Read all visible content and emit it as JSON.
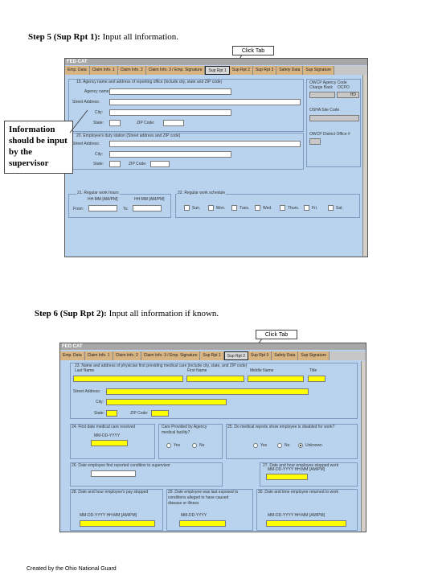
{
  "step5": {
    "title_bold": "Step 5 (Sup Rpt 1):",
    "title_rest": " Input all information.",
    "click_tab": "Click Tab",
    "callout": [
      "Information",
      "should be input",
      "by the",
      "supervisor"
    ],
    "app_logo": "FED CAT",
    "tabs": [
      "Emp. Data",
      "Claim Info. 1",
      "Claim Info. 2",
      "Claim Info. 3 / Emp. Signature",
      "Sup Rpt 1",
      "Sup Rpt 2",
      "Sup Rpt 3",
      "Safety Data",
      "Sup Signature"
    ],
    "active_tab": 4,
    "sec19": {
      "title": "19. Agency name and address of reporting office (include city, state and ZIP code)",
      "agency_name": "Agency name:",
      "street": "Street Address:",
      "city": "City:",
      "state": "State:",
      "zip": "ZIP Code:"
    },
    "owcp": {
      "agency_code": "OWCP Agency Code",
      "charge_back": "Charge Back",
      "ocpo": "OCPO",
      "code_value": "HD",
      "osha_site": "OSHA Site Code",
      "district_office": "OWCP District Office #"
    },
    "sec20": {
      "title": "20. Employee's duty station (Street address and ZIP code)",
      "street": "Street Address:",
      "city": "City:",
      "state": "State:",
      "zip": "ZIP Code:"
    },
    "sec21": {
      "title": "21. Regular work hours",
      "fmt1": "HH:MM [AM/PM]",
      "fmt2": "HH:MM [AM/PM]",
      "from": "From:",
      "to": "To:"
    },
    "sec22": {
      "title": "22. Regular work schedule",
      "days": [
        "Sun.",
        "Mon.",
        "Tues.",
        "Wed.",
        "Thurs.",
        "Fri.",
        "Sat."
      ]
    }
  },
  "step6": {
    "title_bold": "Step 6 (Sup Rpt 2):",
    "title_rest": " Input all information if known.",
    "click_tab": "Click Tab",
    "app_logo": "FED CAT",
    "tabs": [
      "Emp. Data",
      "Claim Info. 1",
      "Claim Info. 2",
      "Claim Info. 3 / Emp. Signature",
      "Sup Rpt 1",
      "Sup Rpt 2",
      "Sup Rpt 3",
      "Safety Data",
      "Sup Signature"
    ],
    "active_tab": 5,
    "sec23": {
      "title": "23. Name and address of physician first providing medical care (include city, state, and ZIP code)",
      "first_name": "First Name",
      "last_name": "Last Name",
      "middle_name": "Middle Name",
      "title_lbl": "Title",
      "street": "Street Address:",
      "city": "City:",
      "state": "State:",
      "zip": "ZIP Code:"
    },
    "sec24": {
      "title": "24. First date medical care received",
      "fmt": "MM-DD-YYYY"
    },
    "provided": {
      "title": "Care Provided by Agency medical facility?",
      "yes": "Yes",
      "no": "No"
    },
    "sec25": {
      "title": "25. Do medical reports show employee is disabled for work?",
      "yes": "Yes",
      "no": "No",
      "unknown": "Unknown"
    },
    "sec26": {
      "title": "26. Date employee first reported condition to supervisor"
    },
    "sec27": {
      "title": "27. Date and hour employee stopped work",
      "fmt": "MM-DD-YYYY HH:MM [AM/PM]"
    },
    "sec28": {
      "title": "28. Date and hour employee's pay stopped",
      "fmt": "MM-DD-YYYY HH:MM [AM/PM]"
    },
    "sec29": {
      "title": "29. Date employee was last exposed to conditions alleged to have caused disease or illness",
      "fmt": "MM-DD-YYYY"
    },
    "sec30": {
      "title": "30. Date and time employee returned to work",
      "fmt": "MM-DD-YYYY HH:MM [AM/PM]"
    }
  },
  "footer": "Created by the Ohio National Guard"
}
